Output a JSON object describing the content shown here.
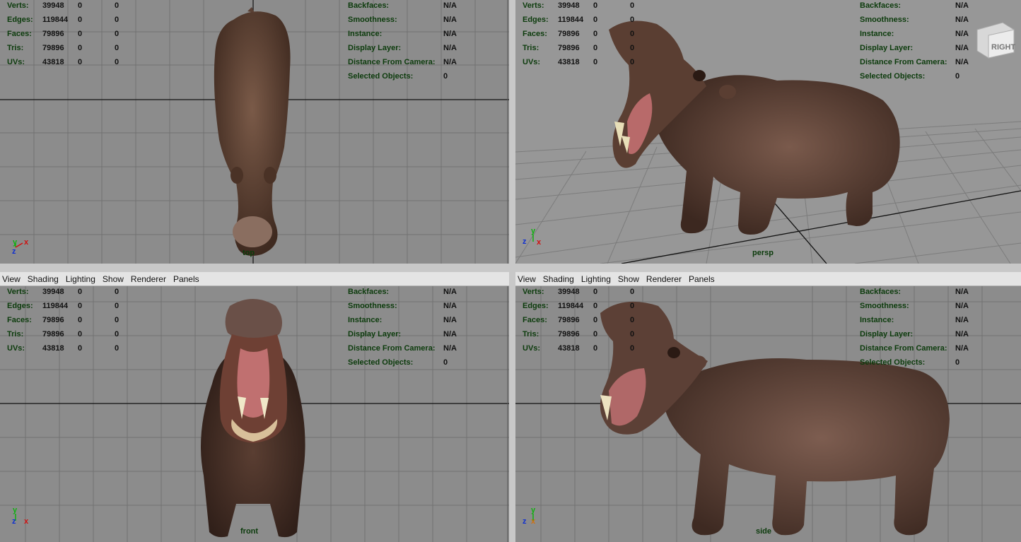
{
  "menu": [
    "View",
    "Shading",
    "Lighting",
    "Show",
    "Renderer",
    "Panels"
  ],
  "stats": {
    "left": [
      {
        "label": "Verts:",
        "value": "39948",
        "a": "0",
        "b": "0"
      },
      {
        "label": "Edges:",
        "value": "119844",
        "a": "0",
        "b": "0"
      },
      {
        "label": "Faces:",
        "value": "79896",
        "a": "0",
        "b": "0"
      },
      {
        "label": "Tris:",
        "value": "79896",
        "a": "0",
        "b": "0"
      },
      {
        "label": "UVs:",
        "value": "43818",
        "a": "0",
        "b": "0"
      }
    ],
    "right": [
      {
        "label": "Backfaces:",
        "value": "N/A"
      },
      {
        "label": "Smoothness:",
        "value": "N/A"
      },
      {
        "label": "Instance:",
        "value": "N/A"
      },
      {
        "label": "Display Layer:",
        "value": "N/A"
      },
      {
        "label": "Distance From Camera:",
        "value": "N/A"
      },
      {
        "label": "Selected Objects:",
        "value": "0"
      }
    ]
  },
  "panes": {
    "top": {
      "camera": "top"
    },
    "persp": {
      "camera": "persp",
      "viewcube_label": "RIGHT"
    },
    "front": {
      "camera": "front"
    },
    "side": {
      "camera": "side"
    }
  },
  "axes": {
    "x": "x",
    "y": "y",
    "z": "z"
  },
  "colors": {
    "viewport_bg": "#8c8c8c",
    "grid_line": "#6f6f6f",
    "grid_axis": "#000000",
    "hud_label": "#0c3b0c",
    "axis_x": "#d01010",
    "axis_y": "#10b010",
    "axis_z": "#1030d0"
  }
}
